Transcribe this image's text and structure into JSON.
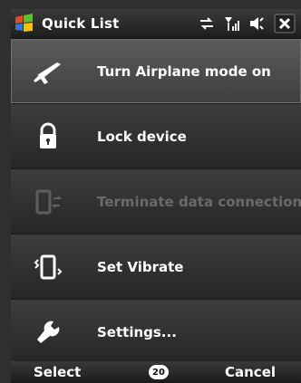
{
  "title_bar": {
    "title": "Quick List",
    "icons": [
      "windows-start-icon",
      "data-sync-icon",
      "signal-icon",
      "speaker-icon",
      "close-icon"
    ]
  },
  "list": {
    "items": [
      {
        "label": "Turn Airplane mode on",
        "icon": "airplane-icon",
        "state": "selected"
      },
      {
        "label": "Lock device",
        "icon": "lock-icon",
        "state": "enabled"
      },
      {
        "label": "Terminate data connection",
        "icon": "data-connection-icon",
        "state": "disabled"
      },
      {
        "label": "Set Vibrate",
        "icon": "vibrate-icon",
        "state": "enabled"
      },
      {
        "label": "Settings...",
        "icon": "wrench-icon",
        "state": "enabled"
      }
    ]
  },
  "soft_keys": {
    "left": "Select",
    "center_badge": "20",
    "right": "Cancel"
  },
  "colors": {
    "selected_row": "#5b5b5b",
    "row": "#333333",
    "disabled_text": "#6a6a6a",
    "text": "#ffffff"
  }
}
